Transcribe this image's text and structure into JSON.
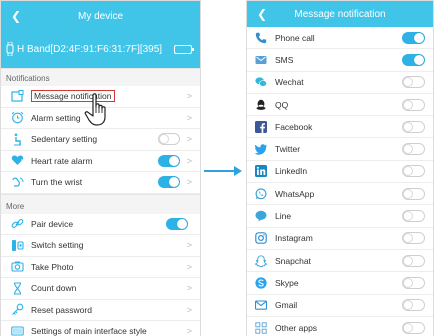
{
  "left": {
    "title": "My device",
    "device_name": "H Band[D2:4F:91:F6:31:7F][395]",
    "notifications_head": "Notifications",
    "notifications": [
      {
        "label": "Message notification",
        "icon": "message-square-icon",
        "control": "chevron",
        "highlighted": true
      },
      {
        "label": "Alarm setting",
        "icon": "alarm-clock-icon",
        "control": "chevron"
      },
      {
        "label": "Sedentary setting",
        "icon": "sitting-person-icon",
        "control": "toggle_chevron",
        "on": false
      },
      {
        "label": "Heart rate alarm",
        "icon": "heart-rate-icon",
        "control": "toggle_chevron",
        "on": true
      },
      {
        "label": "Turn the wrist",
        "icon": "wrist-icon",
        "control": "toggle_chevron",
        "on": true
      }
    ],
    "more_head": "More",
    "more": [
      {
        "label": "Pair device",
        "icon": "link-icon",
        "control": "toggle",
        "on": true
      },
      {
        "label": "Switch setting",
        "icon": "switch-setting-icon",
        "control": "chevron"
      },
      {
        "label": "Take Photo",
        "icon": "camera-icon",
        "control": "chevron"
      },
      {
        "label": "Count down",
        "icon": "hourglass-icon",
        "control": "chevron"
      },
      {
        "label": "Reset password",
        "icon": "key-icon",
        "control": "chevron"
      },
      {
        "label": "Settings of main interface style",
        "icon": "screen-icon",
        "control": "chevron"
      }
    ]
  },
  "right": {
    "title": "Message notification",
    "items": [
      {
        "label": "Phone call",
        "icon": "phone-icon",
        "on": true,
        "color": "#2f8fd1"
      },
      {
        "label": "SMS",
        "icon": "sms-icon",
        "on": true,
        "color": "#5aa0d6"
      },
      {
        "label": "Wechat",
        "icon": "wechat-icon",
        "on": false,
        "color": "#35b8d8"
      },
      {
        "label": "QQ",
        "icon": "qq-icon",
        "on": false,
        "color": "#222222"
      },
      {
        "label": "Facebook",
        "icon": "facebook-icon",
        "on": false,
        "color": "#3b5998"
      },
      {
        "label": "Twitter",
        "icon": "twitter-icon",
        "on": false,
        "color": "#2aa3ef"
      },
      {
        "label": "LinkedIn",
        "icon": "linkedin-icon",
        "on": false,
        "color": "#1b86c4"
      },
      {
        "label": "WhatsApp",
        "icon": "whatsapp-icon",
        "on": false,
        "color": "#3a9fd8"
      },
      {
        "label": "Line",
        "icon": "line-icon",
        "on": false,
        "color": "#3aa6dc"
      },
      {
        "label": "Instagram",
        "icon": "instagram-icon",
        "on": false,
        "color": "#2f8fd1"
      },
      {
        "label": "Snapchat",
        "icon": "snapchat-icon",
        "on": false,
        "color": "#3aa6dc"
      },
      {
        "label": "Skype",
        "icon": "skype-icon",
        "on": false,
        "color": "#2aa3ef"
      },
      {
        "label": "Gmail",
        "icon": "gmail-icon",
        "on": false,
        "color": "#2f8fd1"
      },
      {
        "label": "Other apps",
        "icon": "grid-apps-icon",
        "on": false,
        "color": "#5aa0d6"
      }
    ]
  },
  "colors": {
    "header": "#40c5e9",
    "toggle_on": "#2db2e8",
    "highlight": "#d23a3a",
    "arrow": "#2aa3e0"
  }
}
